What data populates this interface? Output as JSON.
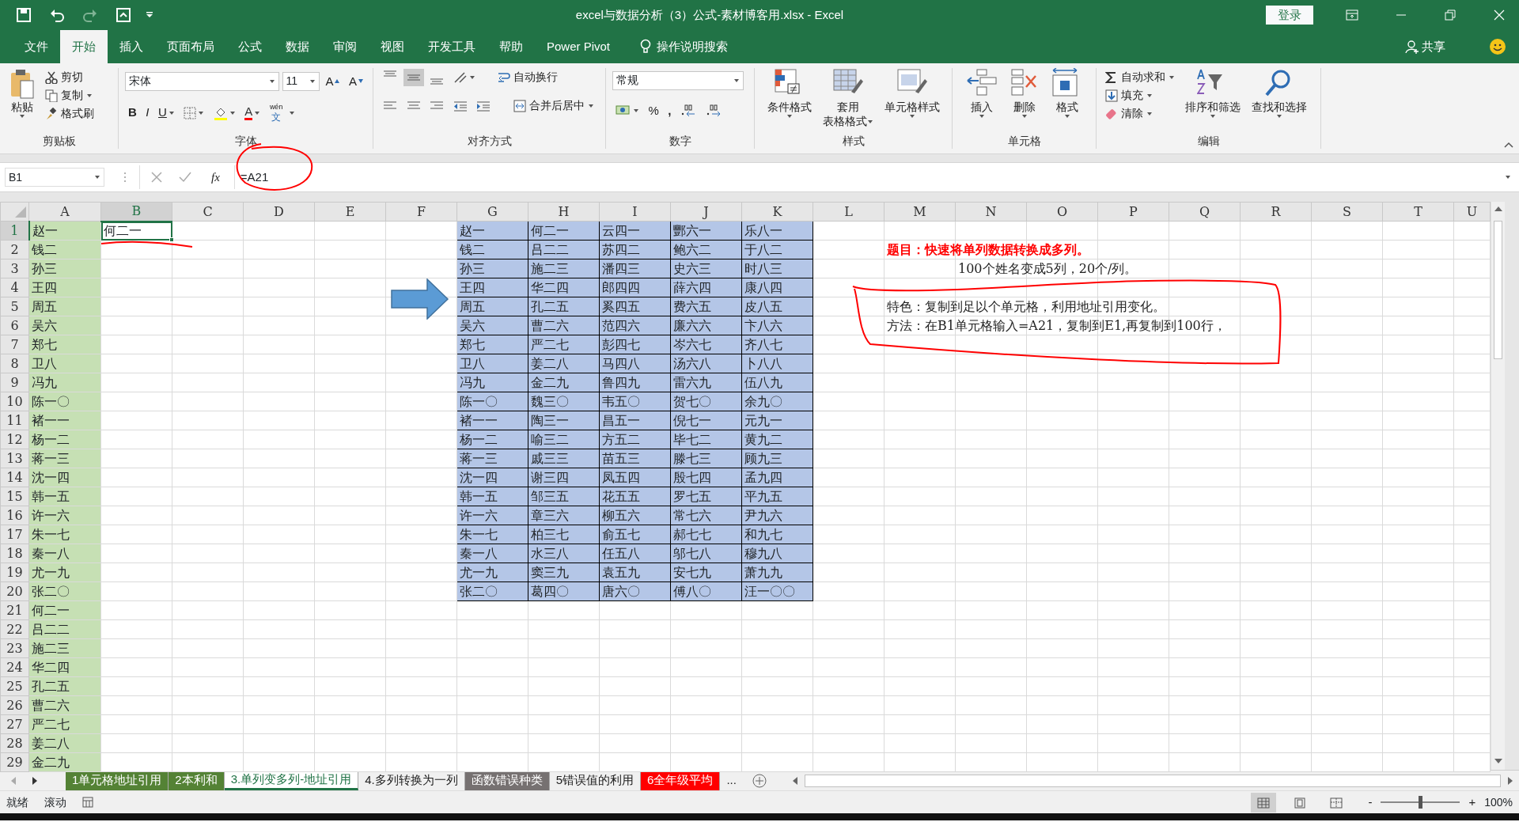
{
  "window": {
    "title": "excel与数据分析（3）公式-素材博客用.xlsx  -  Excel",
    "login": "登录"
  },
  "quick_access": [
    {
      "disabled": false
    },
    {
      "disabled": false
    },
    {
      "disabled": true
    },
    {
      "disabled": false
    }
  ],
  "menu_tabs": [
    {
      "label": "文件",
      "selected": false
    },
    {
      "label": "开始",
      "selected": true
    },
    {
      "label": "插入",
      "selected": false
    },
    {
      "label": "页面布局",
      "selected": false
    },
    {
      "label": "公式",
      "selected": false
    },
    {
      "label": "数据",
      "selected": false
    },
    {
      "label": "审阅",
      "selected": false
    },
    {
      "label": "视图",
      "selected": false
    },
    {
      "label": "开发工具",
      "selected": false
    },
    {
      "label": "帮助",
      "selected": false
    },
    {
      "label": "Power Pivot",
      "selected": false
    }
  ],
  "tell_me": "操作说明搜索",
  "share": "共享",
  "ribbon": [
    {
      "kind": "clipboard",
      "label": "剪贴板",
      "paste": "粘贴",
      "small": [
        "剪切",
        "复制",
        "格式刷"
      ]
    },
    {
      "kind": "font",
      "label": "字体",
      "font_name": "宋体",
      "font_size": "11",
      "size_buttons": [
        "A",
        "A"
      ],
      "style_buttons": [
        "B",
        "I",
        "U"
      ],
      "font_color": "A",
      "phonetic": {
        "ruby": "wén",
        "char": "文"
      }
    },
    {
      "kind": "alignment",
      "label": "对齐方式",
      "vertical_align": [
        {
          "selected": false
        },
        {
          "selected": true
        },
        {
          "selected": false
        }
      ],
      "wrap": "自动换行",
      "merge": "合并后居中"
    },
    {
      "kind": "number",
      "label": "数字",
      "format": "常规",
      "percent": "%",
      "comma": ","
    },
    {
      "kind": "large_buttons",
      "label": "样式",
      "items": [
        {
          "lines": [
            "条件格式"
          ]
        },
        {
          "lines": [
            "套用",
            "表格格式"
          ]
        },
        {
          "lines": [
            "单元格样式"
          ]
        }
      ]
    },
    {
      "kind": "large_buttons",
      "label": "单元格",
      "items": [
        {
          "lines": [
            "插入"
          ]
        },
        {
          "lines": [
            "删除"
          ]
        },
        {
          "lines": [
            "格式"
          ]
        }
      ]
    },
    {
      "kind": "editing",
      "label": "编辑",
      "small": [
        "自动求和",
        "填充",
        "清除"
      ],
      "large": [
        {
          "lines": [
            "排序和筛选"
          ]
        },
        {
          "lines": [
            "查找和选择"
          ]
        }
      ]
    }
  ],
  "formula_bar": {
    "name_box": "B1",
    "fx": "fx",
    "formula": "=A21"
  },
  "column_headers": [
    {
      "label": "A",
      "selected": false
    },
    {
      "label": "B",
      "selected": true
    },
    {
      "label": "C",
      "selected": false
    },
    {
      "label": "D",
      "selected": false
    },
    {
      "label": "E",
      "selected": false
    },
    {
      "label": "F",
      "selected": false
    },
    {
      "label": "G",
      "selected": false
    },
    {
      "label": "H",
      "selected": false
    },
    {
      "label": "I",
      "selected": false
    },
    {
      "label": "J",
      "selected": false
    },
    {
      "label": "K",
      "selected": false
    },
    {
      "label": "L",
      "selected": false
    },
    {
      "label": "M",
      "selected": false
    },
    {
      "label": "N",
      "selected": false
    },
    {
      "label": "O",
      "selected": false
    },
    {
      "label": "P",
      "selected": false
    },
    {
      "label": "Q",
      "selected": false
    },
    {
      "label": "R",
      "selected": false
    },
    {
      "label": "S",
      "selected": false
    },
    {
      "label": "T",
      "selected": false
    },
    {
      "label": "U",
      "selected": false
    }
  ],
  "row_headers": [
    {
      "label": "1",
      "selected": true
    },
    {
      "label": "2",
      "selected": false
    },
    {
      "label": "3",
      "selected": false
    },
    {
      "label": "4",
      "selected": false
    },
    {
      "label": "5",
      "selected": false
    },
    {
      "label": "6",
      "selected": false
    },
    {
      "label": "7",
      "selected": false
    },
    {
      "label": "8",
      "selected": false
    },
    {
      "label": "9",
      "selected": false
    },
    {
      "label": "10",
      "selected": false
    },
    {
      "label": "11",
      "selected": false
    },
    {
      "label": "12",
      "selected": false
    },
    {
      "label": "13",
      "selected": false
    },
    {
      "label": "14",
      "selected": false
    },
    {
      "label": "15",
      "selected": false
    },
    {
      "label": "16",
      "selected": false
    },
    {
      "label": "17",
      "selected": false
    },
    {
      "label": "18",
      "selected": false
    },
    {
      "label": "19",
      "selected": false
    },
    {
      "label": "20",
      "selected": false
    },
    {
      "label": "21",
      "selected": false
    },
    {
      "label": "22",
      "selected": false
    },
    {
      "label": "23",
      "selected": false
    },
    {
      "label": "24",
      "selected": false
    },
    {
      "label": "25",
      "selected": false
    },
    {
      "label": "26",
      "selected": false
    },
    {
      "label": "27",
      "selected": false
    },
    {
      "label": "28",
      "selected": false
    },
    {
      "label": "29",
      "selected": false
    }
  ],
  "column_a": [
    "赵一",
    "钱二",
    "孙三",
    "王四",
    "周五",
    "吴六",
    "郑七",
    "卫八",
    "冯九",
    "陈一〇",
    "褚一一",
    "杨一二",
    "蒋一三",
    "沈一四",
    "韩一五",
    "许一六",
    "朱一七",
    "秦一八",
    "尤一九",
    "张二〇",
    "何二一",
    "吕二二",
    "施二三",
    "华二四",
    "孔二五",
    "曹二六",
    "严二七",
    "姜二八",
    "金二九"
  ],
  "column_b": [
    {
      "text": "何二一",
      "selected": true
    }
  ],
  "result_block": [
    [
      "赵一",
      "何二一",
      "云四一",
      "酆六一",
      "乐八一"
    ],
    [
      "钱二",
      "吕二二",
      "苏四二",
      "鲍六二",
      "于八二"
    ],
    [
      "孙三",
      "施二三",
      "潘四三",
      "史六三",
      "时八三"
    ],
    [
      "王四",
      "华二四",
      "郎四四",
      "薛六四",
      "康八四"
    ],
    [
      "周五",
      "孔二五",
      "奚四五",
      "费六五",
      "皮八五"
    ],
    [
      "吴六",
      "曹二六",
      "范四六",
      "廉六六",
      "卞八六"
    ],
    [
      "郑七",
      "严二七",
      "彭四七",
      "岑六七",
      "齐八七"
    ],
    [
      "卫八",
      "姜二八",
      "马四八",
      "汤六八",
      "卜八八"
    ],
    [
      "冯九",
      "金二九",
      "鲁四九",
      "雷六九",
      "伍八九"
    ],
    [
      "陈一〇",
      "魏三〇",
      "韦五〇",
      "贺七〇",
      "余九〇"
    ],
    [
      "褚一一",
      "陶三一",
      "昌五一",
      "倪七一",
      "元九一"
    ],
    [
      "杨一二",
      "喻三二",
      "方五二",
      "毕七二",
      "黄九二"
    ],
    [
      "蒋一三",
      "戚三三",
      "苗五三",
      "滕七三",
      "顾九三"
    ],
    [
      "沈一四",
      "谢三四",
      "凤五四",
      "殷七四",
      "孟九四"
    ],
    [
      "韩一五",
      "邹三五",
      "花五五",
      "罗七五",
      "平九五"
    ],
    [
      "许一六",
      "章三六",
      "柳五六",
      "常七六",
      "尹九六"
    ],
    [
      "朱一七",
      "柏三七",
      "俞五七",
      "郝七七",
      "和九七"
    ],
    [
      "秦一八",
      "水三八",
      "任五八",
      "邬七八",
      "穆九八"
    ],
    [
      "尤一九",
      "窦三九",
      "袁五九",
      "安七九",
      "萧九九"
    ],
    [
      "张二〇",
      "葛四〇",
      "唐六〇",
      "傅八〇",
      "汪一〇〇"
    ]
  ],
  "notes": [
    {
      "kind": "title",
      "text": "题目：快速将单列数据转换成多列。"
    },
    {
      "kind": "subtitle",
      "text": "100个姓名变成5列，20个/列。"
    },
    {
      "kind": "body",
      "text": "特色：复制到足以个单元格，利用地址引用变化。"
    },
    {
      "kind": "body",
      "text": "方法：在B1单元格输入=A21，复制到E1,再复制到100行，"
    }
  ],
  "sheet_tabs": [
    {
      "label": "1单元格地址引用",
      "selected": false,
      "color": "#548235"
    },
    {
      "label": "2本利和",
      "selected": false,
      "color": "#548235"
    },
    {
      "label": "3.单列变多列-地址引用",
      "selected": true
    },
    {
      "label": "4.多列转换为一列",
      "selected": false
    },
    {
      "label": "函数错误种类",
      "selected": false,
      "color": "#767171"
    },
    {
      "label": "5错误值的利用",
      "selected": false
    },
    {
      "label": "6全年级平均",
      "selected": false,
      "color": "#ff0000"
    }
  ],
  "sheet_more": "...",
  "status_bar": {
    "ready": "就绪",
    "scroll": "滚动",
    "views": [
      {
        "selected": true
      },
      {
        "selected": false
      },
      {
        "selected": false
      }
    ],
    "zoom_out": "-",
    "zoom_in": "+",
    "zoom": {
      "level": 0.5
    },
    "zoom_text": "100%"
  }
}
